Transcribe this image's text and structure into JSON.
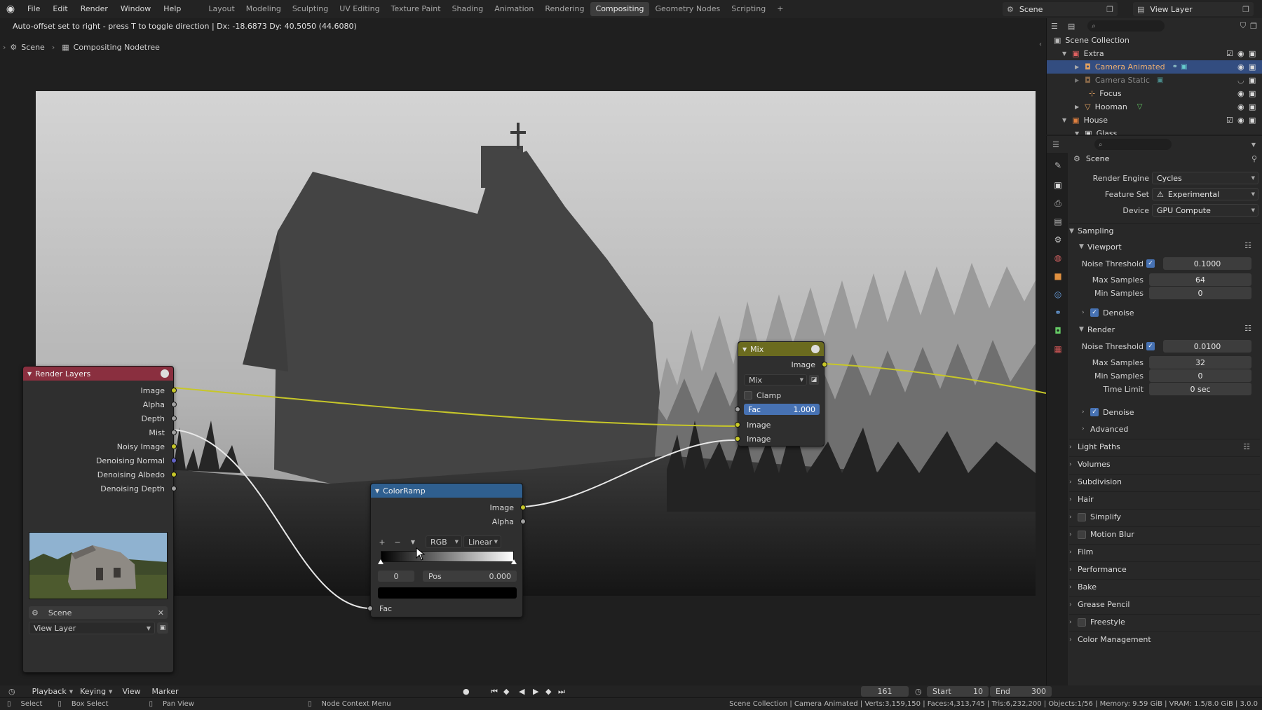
{
  "menu": {
    "items": [
      "File",
      "Edit",
      "Render",
      "Window",
      "Help"
    ],
    "workspaces": [
      "Layout",
      "Modeling",
      "Sculpting",
      "UV Editing",
      "Texture Paint",
      "Shading",
      "Animation",
      "Rendering",
      "Compositing",
      "Geometry Nodes",
      "Scripting"
    ],
    "active_workspace": "Compositing",
    "add_tab": "+",
    "scene_name": "Scene",
    "view_layer": "View Layer"
  },
  "editor": {
    "status_message": "Auto-offset set to right - press T to toggle direction  |  Dx: -18.6873   Dy: 40.5050 (44.6080)",
    "breadcrumb": [
      "Scene",
      "Compositing Nodetree"
    ]
  },
  "nodes": {
    "render_layers": {
      "title": "Render Layers",
      "header_color": "#8a2f3f",
      "outputs": [
        "Image",
        "Alpha",
        "Depth",
        "Mist",
        "Noisy Image",
        "Denoising Normal",
        "Denoising Albedo",
        "Denoising Depth"
      ],
      "scene": "Scene",
      "view_layer": "View Layer"
    },
    "color_ramp": {
      "title": "ColorRamp",
      "header_color": "#2f5f8f",
      "outputs": [
        "Image",
        "Alpha"
      ],
      "color_mode": "RGB",
      "interpolation": "Linear",
      "index": "0",
      "pos_label": "Pos",
      "pos_value": "0.000",
      "input": "Fac"
    },
    "mix": {
      "title": "Mix",
      "header_color": "#6b6b1f",
      "output": "Image",
      "blend_mode": "Mix",
      "clamp_label": "Clamp",
      "fac_label": "Fac",
      "fac_value": "1.000",
      "fac_fraction": 1.0,
      "inputs": [
        "Image",
        "Image"
      ]
    }
  },
  "outliner": {
    "root": "Scene Collection",
    "rows": [
      {
        "label": "Extra",
        "icon": "collection-icon"
      },
      {
        "label": "Camera Animated",
        "icon": "camera-icon",
        "selected": true
      },
      {
        "label": "Camera Static",
        "icon": "camera-icon",
        "dim": true
      },
      {
        "label": "Focus",
        "icon": "empty-icon"
      },
      {
        "label": "Hooman",
        "icon": "mesh-icon"
      },
      {
        "label": "House",
        "icon": "collection-icon"
      },
      {
        "label": "Glass",
        "icon": "collection-icon"
      }
    ]
  },
  "properties": {
    "context": "Scene",
    "render_engine_label": "Render Engine",
    "render_engine": "Cycles",
    "feature_set_label": "Feature Set",
    "feature_set": "Experimental",
    "device_label": "Device",
    "device": "GPU Compute",
    "sampling": "Sampling",
    "viewport": {
      "title": "Viewport",
      "noise_threshold_label": "Noise Threshold",
      "noise_threshold": "0.1000",
      "max_samples_label": "Max Samples",
      "max_samples": "64",
      "min_samples_label": "Min Samples",
      "min_samples": "0",
      "denoise": "Denoise"
    },
    "render": {
      "title": "Render",
      "noise_threshold_label": "Noise Threshold",
      "noise_threshold": "0.0100",
      "max_samples_label": "Max Samples",
      "max_samples": "32",
      "min_samples_label": "Min Samples",
      "min_samples": "0",
      "time_limit_label": "Time Limit",
      "time_limit": "0 sec",
      "denoise": "Denoise",
      "advanced": "Advanced"
    },
    "panels": [
      "Light Paths",
      "Volumes",
      "Subdivision",
      "Hair",
      "Simplify",
      "Motion Blur",
      "Film",
      "Performance",
      "Bake",
      "Grease Pencil",
      "Freestyle",
      "Color Management"
    ]
  },
  "timeline": {
    "menus": [
      "Playback",
      "Keying",
      "View",
      "Marker"
    ],
    "current_frame": "161",
    "start_label": "Start",
    "start": "10",
    "end_label": "End",
    "end": "300"
  },
  "statusbar": {
    "select": "Select",
    "box_select": "Box Select",
    "pan_view": "Pan View",
    "context_menu": "Node Context Menu",
    "stats": "Scene Collection | Camera Animated | Verts:3,159,150 | Faces:4,313,745 | Tris:6,232,200 | Objects:1/56 | Memory: 9.59 GiB | VRAM: 1.5/8.0 GiB | 3.0.0"
  }
}
